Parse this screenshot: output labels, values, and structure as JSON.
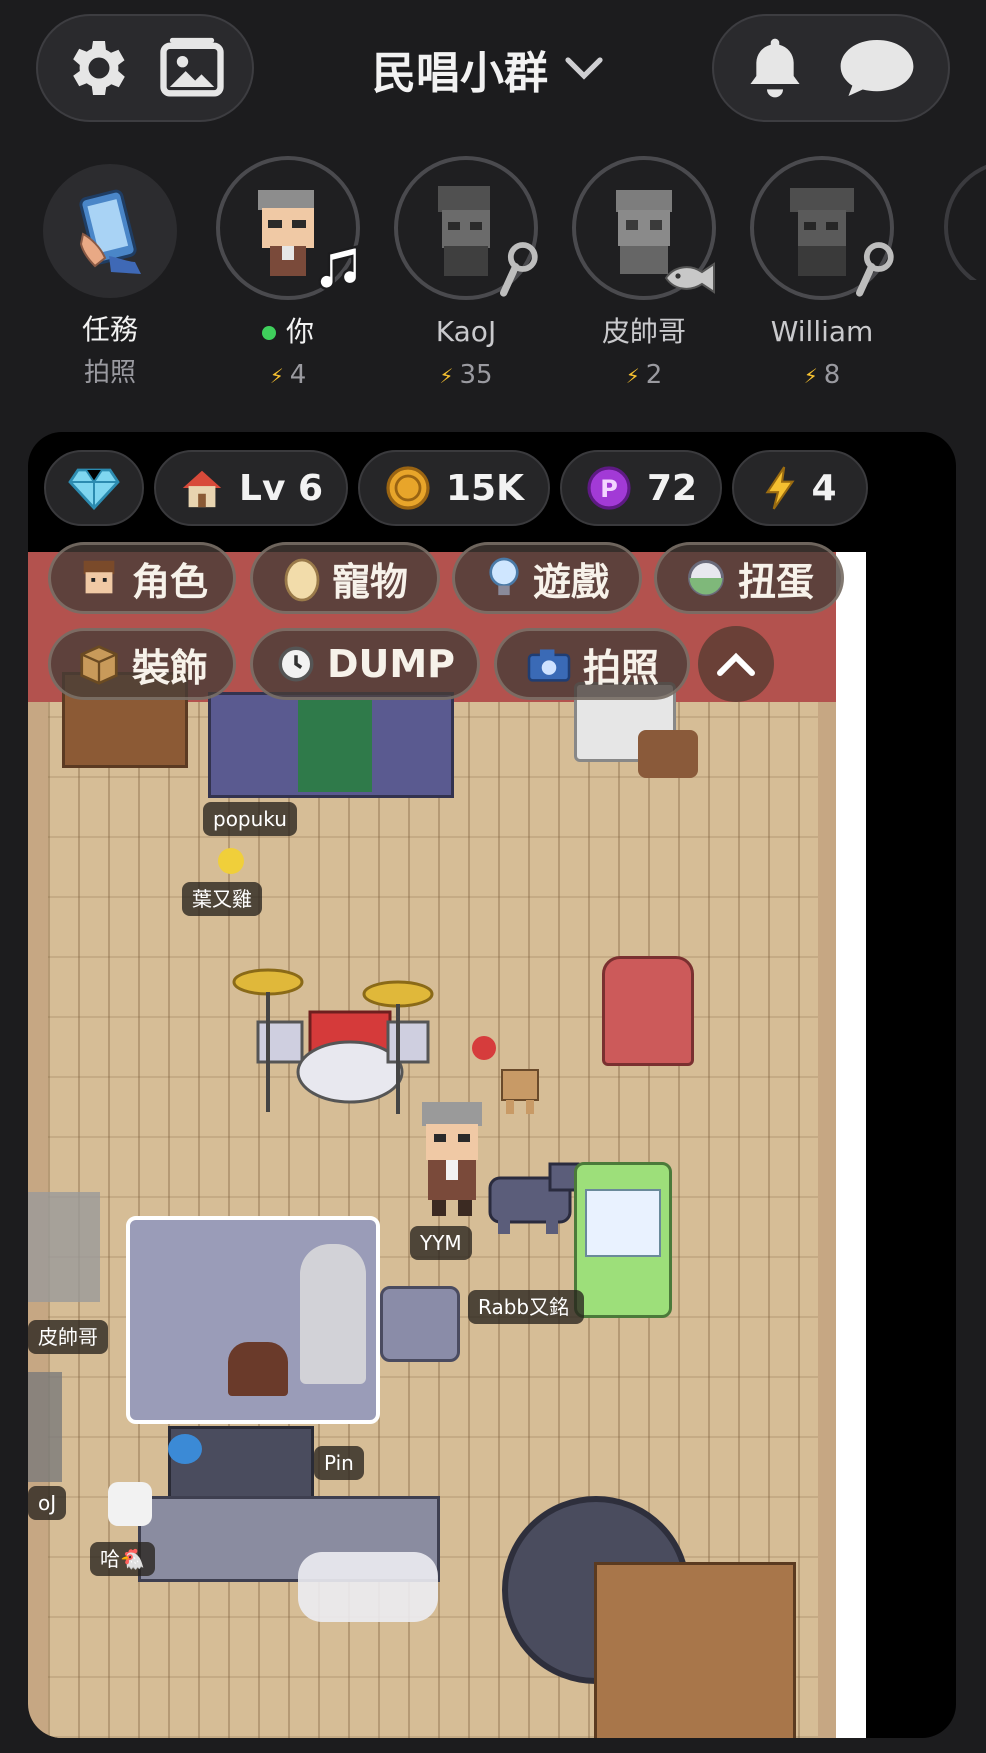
{
  "header": {
    "title": "民唱小群",
    "left_icons": [
      "gear-icon",
      "gallery-icon"
    ],
    "right_icons": [
      "bell-icon",
      "chat-icon"
    ]
  },
  "members": [
    {
      "name": "任務",
      "sub": "拍照",
      "type": "task",
      "icon": "phone-hand-icon"
    },
    {
      "name": "你",
      "points": "4",
      "online": true,
      "badge": "music-note-icon"
    },
    {
      "name": "KaoJ",
      "points": "35",
      "badge": "microphone-icon"
    },
    {
      "name": "皮帥哥",
      "points": "2",
      "badge": "fish-icon"
    },
    {
      "name": "William",
      "points": "8",
      "badge": "microphone-icon"
    }
  ],
  "stats": {
    "level": "Lv 6",
    "coins": "15K",
    "points": "72",
    "energy": "4"
  },
  "actions": {
    "character": "角色",
    "pet": "寵物",
    "game": "遊戲",
    "gacha": "扭蛋",
    "decor": "裝飾",
    "dump": "DUMP",
    "photo": "拍照"
  },
  "room_tags": {
    "popuku": "popuku",
    "ye_you_ji": "葉又雞",
    "yym": "YYM",
    "rabb": "Rabb又銘",
    "pi_shuai_ge": "皮帥哥",
    "pin": "Pin",
    "oj": "oJ",
    "ha": "哈"
  },
  "colors": {
    "background": "#1c1c1e",
    "online": "#3fcf5c",
    "energy": "#f5c030",
    "wall": "#b3524e",
    "floor": "#d6bd96"
  }
}
